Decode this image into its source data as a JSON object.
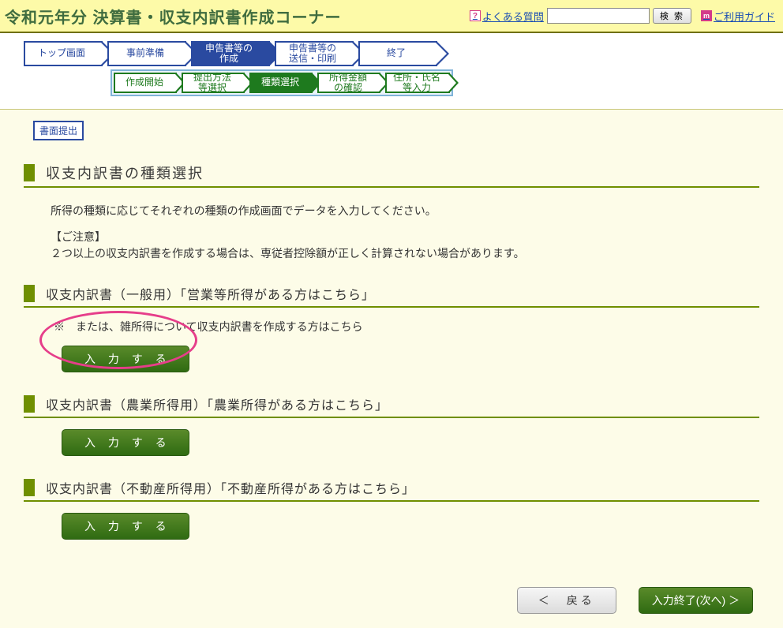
{
  "header": {
    "title": "令和元年分 決算書・収支内訳書作成コーナー",
    "faq_label": "よくある質問",
    "search_button": "検 索",
    "guide_label": "ご利用ガイド"
  },
  "nav_main": [
    {
      "label": "トップ画面"
    },
    {
      "label": "事前準備"
    },
    {
      "label": "申告書等の\n作成",
      "active": true
    },
    {
      "label": "申告書等の\n送信・印刷"
    },
    {
      "label": "終了"
    }
  ],
  "nav_sub": [
    {
      "label": "作成開始"
    },
    {
      "label": "提出方法\n等選択"
    },
    {
      "label": "種類選択",
      "active": true
    },
    {
      "label": "所得金額\nの確認"
    },
    {
      "label": "住所・氏名\n等入力"
    }
  ],
  "badge": "書面提出",
  "main_title": "収支内訳書の種類選択",
  "instruction": "所得の種類に応じてそれぞれの種類の作成画面でデータを入力してください。",
  "caution_heading": "【ご注意】",
  "caution_body": "２つ以上の収支内訳書を作成する場合は、専従者控除額が正しく計算されない場合があります。",
  "sections": [
    {
      "title": "収支内訳書（一般用）「営業等所得がある方はこちら」",
      "note": "※　または、雑所得について収支内訳書を作成する方はこちら",
      "button": "入 力 す る",
      "highlighted": true
    },
    {
      "title": "収支内訳書（農業所得用）「農業所得がある方はこちら」",
      "button": "入 力 す る"
    },
    {
      "title": "収支内訳書（不動産所得用）「不動産所得がある方はこちら」",
      "button": "入 力 す る"
    }
  ],
  "footer": {
    "back": "＜　戻る",
    "next": "入力終了(次へ) ＞"
  }
}
